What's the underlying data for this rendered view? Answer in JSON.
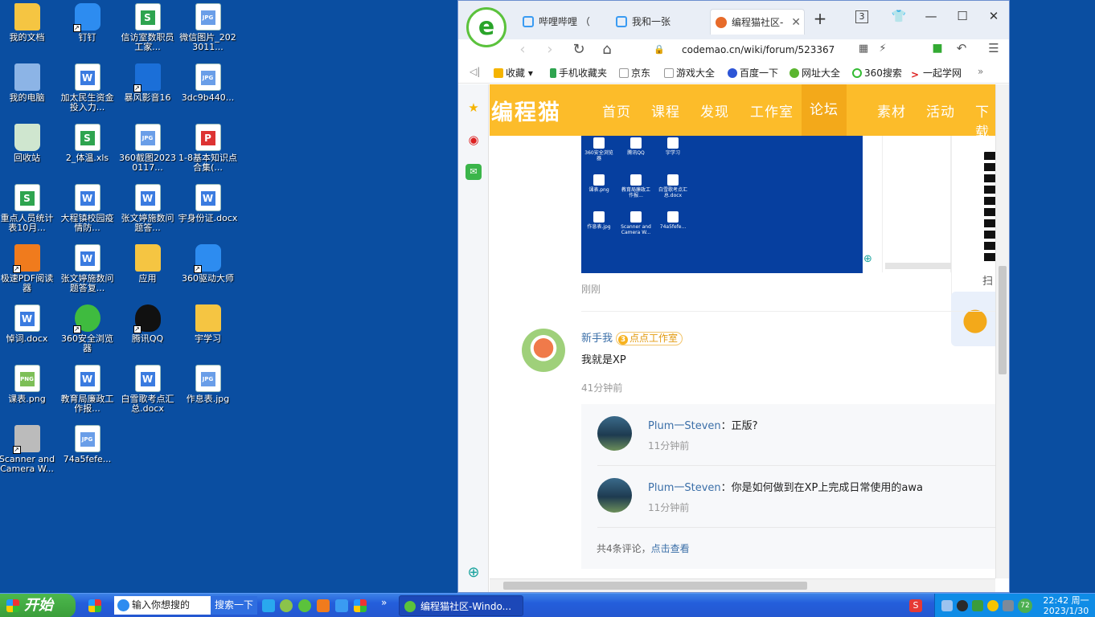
{
  "desktop": {
    "icons": [
      {
        "label": "我的文档",
        "icon": "folder"
      },
      {
        "label": "钉钉",
        "icon": "dingtalk-icon"
      },
      {
        "label": "信访室数职员工家...",
        "icon": "xls"
      },
      {
        "label": "微信图片_2023011...",
        "icon": "jpg"
      },
      {
        "label": "我的电脑",
        "icon": "computer"
      },
      {
        "label": "加太民生资金投入力...",
        "icon": "doc"
      },
      {
        "label": "暴风影音16",
        "icon": "movie"
      },
      {
        "label": "3dc9b440...",
        "icon": "jpg"
      },
      {
        "label": "回收站",
        "icon": "recycle-bin"
      },
      {
        "label": "2_体温.xls",
        "icon": "xls"
      },
      {
        "label": "360截图20230117...",
        "icon": "jpg"
      },
      {
        "label": "1-8基本知识点合集(...",
        "icon": "pdf"
      },
      {
        "label": "重点人员统计表10月...",
        "icon": "xls"
      },
      {
        "label": "大程镇校园疫情防...",
        "icon": "doc"
      },
      {
        "label": "张文婷施数问题答...",
        "icon": "doc"
      },
      {
        "label": "宇身份证.docx",
        "icon": "doc"
      },
      {
        "label": "极速PDF阅读器",
        "icon": "pdf-reader"
      },
      {
        "label": "张文婷施数问题答复...",
        "icon": "doc"
      },
      {
        "label": "应用",
        "icon": "folder"
      },
      {
        "label": "360驱动大师",
        "icon": "driver"
      },
      {
        "label": "悼词.docx",
        "icon": "doc"
      },
      {
        "label": "360安全浏览器",
        "icon": "360browser"
      },
      {
        "label": "腾讯QQ",
        "icon": "qq"
      },
      {
        "label": "宇学习",
        "icon": "folder"
      },
      {
        "label": "课表.png",
        "icon": "png"
      },
      {
        "label": "教育局廉政工作报...",
        "icon": "doc"
      },
      {
        "label": "白雪歌考点汇总.docx",
        "icon": "doc"
      },
      {
        "label": "作息表.jpg",
        "icon": "jpg"
      },
      {
        "label": "Scanner and Camera W...",
        "icon": "camera"
      },
      {
        "label": "74a5fefe...",
        "icon": "jpg"
      }
    ]
  },
  "browser": {
    "tabs": [
      {
        "label": "哔哩哔哩 （",
        "active": false
      },
      {
        "label": "我和一张",
        "active": false
      },
      {
        "label": "编程猫社区-",
        "active": true
      }
    ],
    "new_tab": "+",
    "tab_count": "3",
    "url": "codemao.cn/wiki/forum/523367",
    "bookmarks": [
      {
        "label": "收藏"
      },
      {
        "label": "手机收藏夹"
      },
      {
        "label": "京东"
      },
      {
        "label": "游戏大全"
      },
      {
        "label": "百度一下"
      },
      {
        "label": "网址大全"
      },
      {
        "label": "360搜索"
      },
      {
        "label": "一起学网"
      }
    ],
    "bookmarks_more": "»",
    "sidebar_collapse": "◁|"
  },
  "site": {
    "logo": "编程猫",
    "nav": [
      "首页",
      "课程",
      "发现",
      "工作室",
      "论坛",
      "素材",
      "活动",
      "下载A"
    ],
    "active_nav": "论坛",
    "shot_icons": [
      {
        "label": "360安全浏览器"
      },
      {
        "label": "腾讯QQ"
      },
      {
        "label": "宇学习"
      },
      {
        "label": "课表.png"
      },
      {
        "label": "教育局廉政工作报..."
      },
      {
        "label": "白雪歌考点汇总.docx"
      },
      {
        "label": "作息表.jpg"
      },
      {
        "label": "Scanner and Camera W..."
      },
      {
        "label": "74a5fefe..."
      }
    ],
    "post_time": "刚刚",
    "right_qr_label": "扫",
    "comment": {
      "user": "新手我",
      "badge_level": "3",
      "badge_text": "点点工作室",
      "text": "我就是XP",
      "time": "41分钟前"
    },
    "replies": [
      {
        "user": "Plum一Steven",
        "text": "：正版?",
        "time": "11分钟前"
      },
      {
        "user": "Plum一Steven",
        "text": "：你是如何做到在XP上完成日常使用的awa",
        "time": "11分钟前"
      }
    ],
    "reply_summary": "共4条评论，",
    "reply_link": "点击查看"
  },
  "taskbar": {
    "start": "开始",
    "search_placeholder": "输入你想搜的",
    "search_button": "搜索一下",
    "task": "编程猫社区-Windo...",
    "more": "»",
    "clock_time": "22:42 周一",
    "clock_date": "2023/1/30",
    "tray_temp": "72"
  },
  "colors": {
    "desktop": "#0a4ea1",
    "site_nav": "#fcbc2a",
    "taskbar": "#245edb"
  }
}
